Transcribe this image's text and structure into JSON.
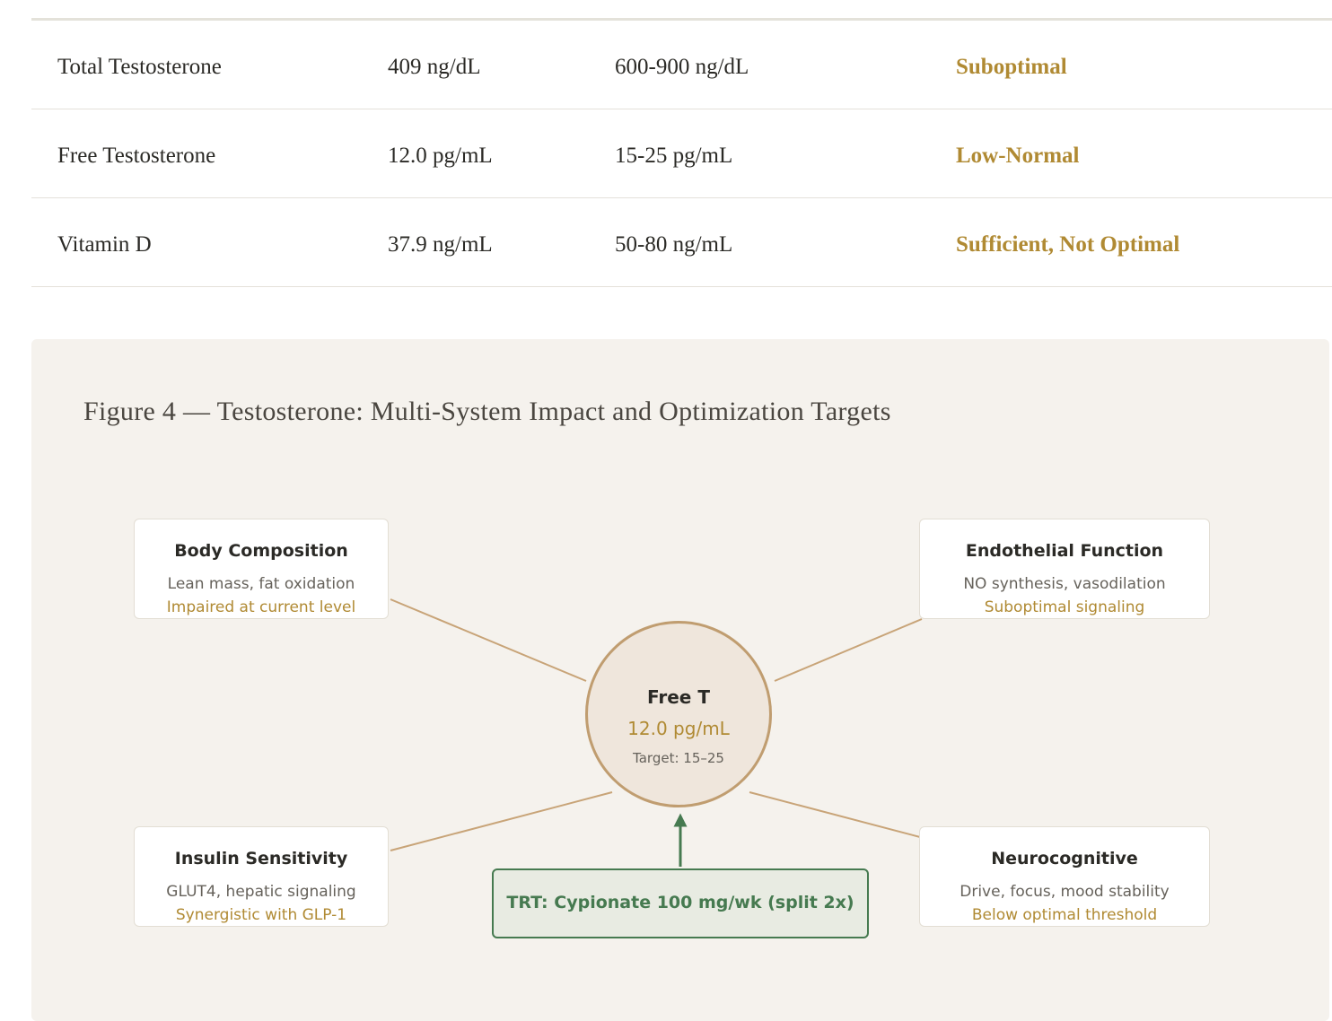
{
  "lab_table": {
    "rows": [
      {
        "name": "Total Testosterone",
        "value": "409 ng/dL",
        "range": "600-900 ng/dL",
        "status": "Suboptimal"
      },
      {
        "name": "Free Testosterone",
        "value": "12.0 pg/mL",
        "range": "15-25 pg/mL",
        "status": "Low-Normal"
      },
      {
        "name": "Vitamin D",
        "value": "37.9 ng/mL",
        "range": "50-80 ng/mL",
        "status": "Sufficient, Not Optimal"
      }
    ]
  },
  "figure": {
    "title": "Figure 4 — Testosterone: Multi-System Impact and Optimization Targets",
    "center": {
      "title": "Free T",
      "value": "12.0 pg/mL",
      "target": "Target: 15–25"
    },
    "nodes": {
      "body_composition": {
        "title": "Body Composition",
        "desc": "Lean mass, fat oxidation",
        "note": "Impaired at current level"
      },
      "endothelial_function": {
        "title": "Endothelial Function",
        "desc": "NO synthesis, vasodilation",
        "note": "Suboptimal signaling"
      },
      "insulin_sensitivity": {
        "title": "Insulin Sensitivity",
        "desc": "GLUT4, hepatic signaling",
        "note": "Synergistic with GLP-1"
      },
      "neurocognitive": {
        "title": "Neurocognitive",
        "desc": "Drive, focus, mood stability",
        "note": "Below optimal threshold"
      }
    },
    "intervention": {
      "label": "TRT: Cypionate 100 mg/wk (split 2x)"
    },
    "colors": {
      "accent_gold": "#b08a33",
      "connector": "#c8a478",
      "intervention_green": "#467a50",
      "panel_bg": "#f5f2ed"
    }
  }
}
